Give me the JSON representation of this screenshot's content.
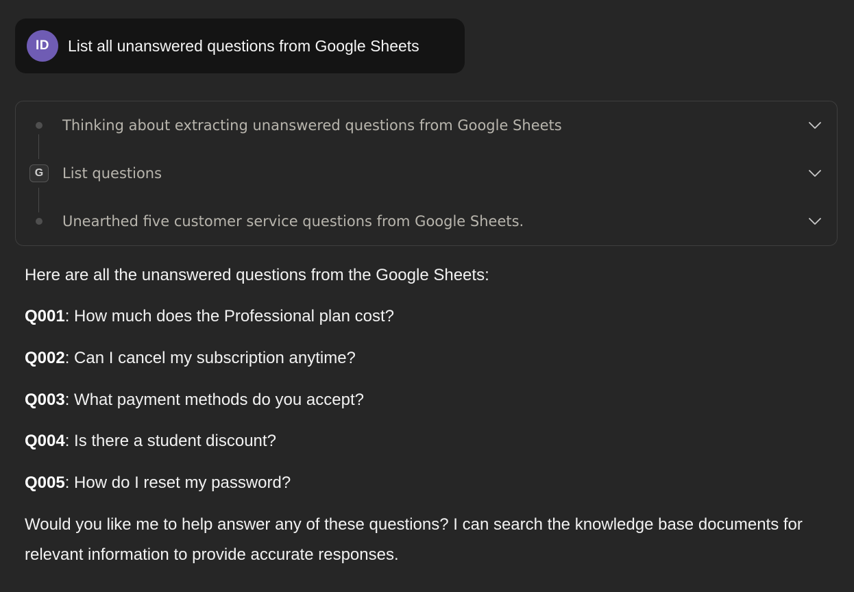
{
  "user_message": {
    "avatar_initials": "ID",
    "text": "List all unanswered questions from Google Sheets"
  },
  "steps": [
    {
      "marker": "dot",
      "label": "Thinking about extracting unanswered questions from Google Sheets",
      "icon": "chevron-down-icon"
    },
    {
      "marker": "G",
      "label": "List questions",
      "icon": "chevron-down-icon"
    },
    {
      "marker": "dot",
      "label": "Unearthed five customer service questions from Google Sheets.",
      "icon": "chevron-down-icon"
    }
  ],
  "response": {
    "intro": "Here are all the unanswered questions from the Google Sheets:",
    "questions": [
      {
        "id": "Q001",
        "text": ": How much does the Professional plan cost?"
      },
      {
        "id": "Q002",
        "text": ": Can I cancel my subscription anytime?"
      },
      {
        "id": "Q003",
        "text": ": What payment methods do you accept?"
      },
      {
        "id": "Q004",
        "text": ": Is there a student discount?"
      },
      {
        "id": "Q005",
        "text": ": How do I reset my password?"
      }
    ],
    "closing": "Would you like me to help answer any of these questions? I can search the knowledge base documents for relevant information to provide accurate responses."
  },
  "colors": {
    "background": "#262626",
    "user_bubble": "#141414",
    "avatar": "#6f5cb4",
    "step_text": "#b8b5ad"
  }
}
